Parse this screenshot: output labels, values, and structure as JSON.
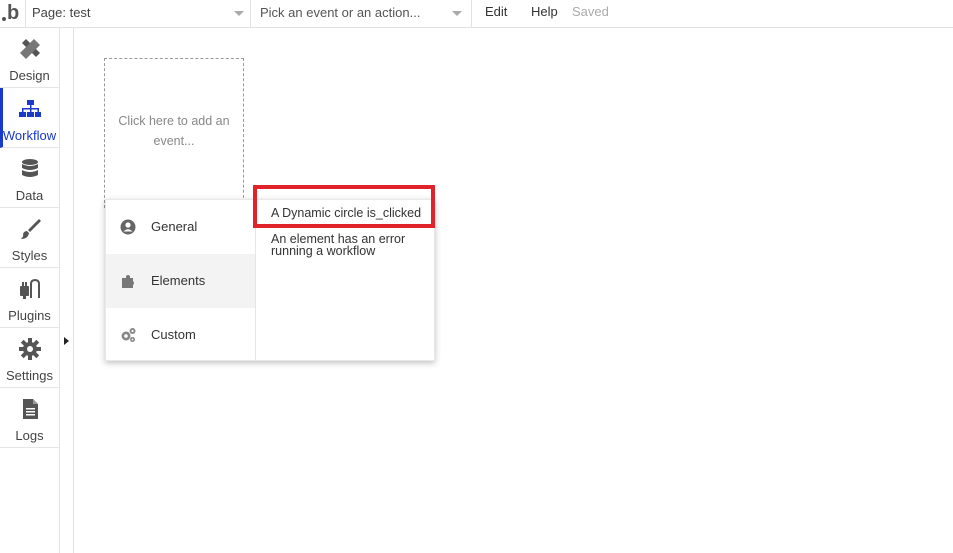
{
  "topbar": {
    "logo_text": "b",
    "page_selector": "Page: test",
    "event_selector_placeholder": "Pick an event or an action...",
    "menu": {
      "edit": "Edit",
      "help": "Help",
      "status": "Saved"
    }
  },
  "sidebar": {
    "items": [
      {
        "label": "Design",
        "icon": "design-icon"
      },
      {
        "label": "Workflow",
        "icon": "workflow-icon",
        "active": true
      },
      {
        "label": "Data",
        "icon": "database-icon"
      },
      {
        "label": "Styles",
        "icon": "brush-icon"
      },
      {
        "label": "Plugins",
        "icon": "plug-icon"
      },
      {
        "label": "Settings",
        "icon": "gear-icon"
      },
      {
        "label": "Logs",
        "icon": "document-icon"
      }
    ]
  },
  "canvas": {
    "event_placeholder": "Click here to add an event..."
  },
  "event_menu": {
    "categories": [
      {
        "label": "General",
        "icon": "user-circle-icon"
      },
      {
        "label": "Elements",
        "icon": "puzzle-icon",
        "selected": true
      },
      {
        "label": "Custom",
        "icon": "gears-icon"
      }
    ],
    "options": [
      "A Dynamic circle is_clicked",
      "An element has an error running a workflow"
    ]
  },
  "colors": {
    "accent": "#1a3ac9",
    "highlight": "#e0222a"
  }
}
